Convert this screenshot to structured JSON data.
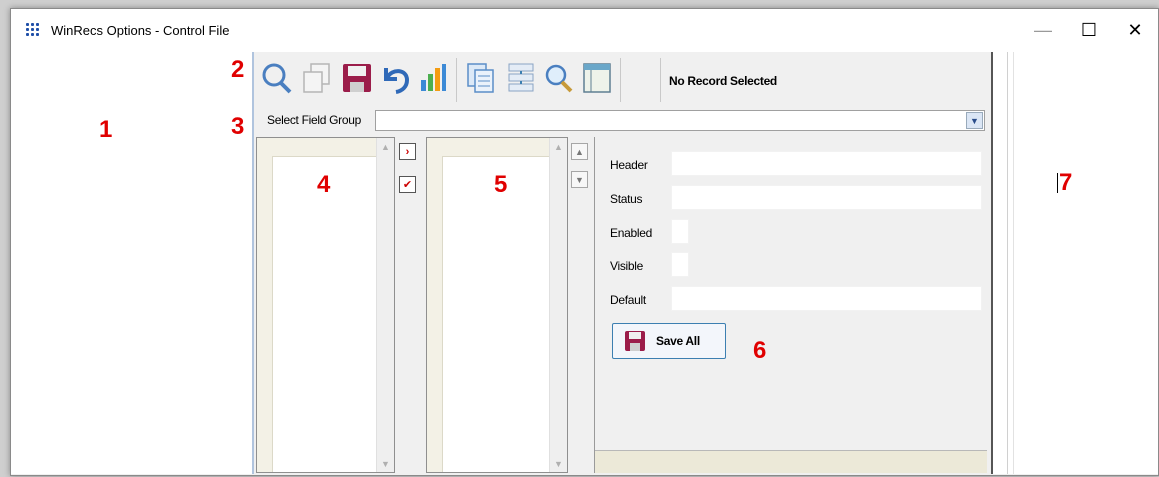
{
  "window": {
    "title": "WinRecs Options - Control File",
    "minimize": "—",
    "maximize": "☐",
    "close": "✕"
  },
  "toolbar": {
    "status": "No Record Selected",
    "icons": [
      "search-icon",
      "new-record-icon",
      "save-icon",
      "undo-icon",
      "chart-icon",
      "copy-icon",
      "hierarchy-icon",
      "zoom-icon",
      "layout-icon"
    ]
  },
  "field_group": {
    "label": "Select Field Group",
    "value": ""
  },
  "details": {
    "fields": [
      {
        "label": "Header",
        "value": ""
      },
      {
        "label": "Status",
        "value": ""
      },
      {
        "label": "Enabled",
        "value": ""
      },
      {
        "label": "Visible",
        "value": ""
      },
      {
        "label": "Default",
        "value": ""
      }
    ],
    "save_all": "Save All"
  },
  "annotations": [
    "1",
    "2",
    "3",
    "4",
    "5",
    "6",
    "7"
  ],
  "colors": {
    "annotation": "#e00000",
    "accent": "#3c7fb1",
    "save_icon": "#9b1d4a"
  }
}
